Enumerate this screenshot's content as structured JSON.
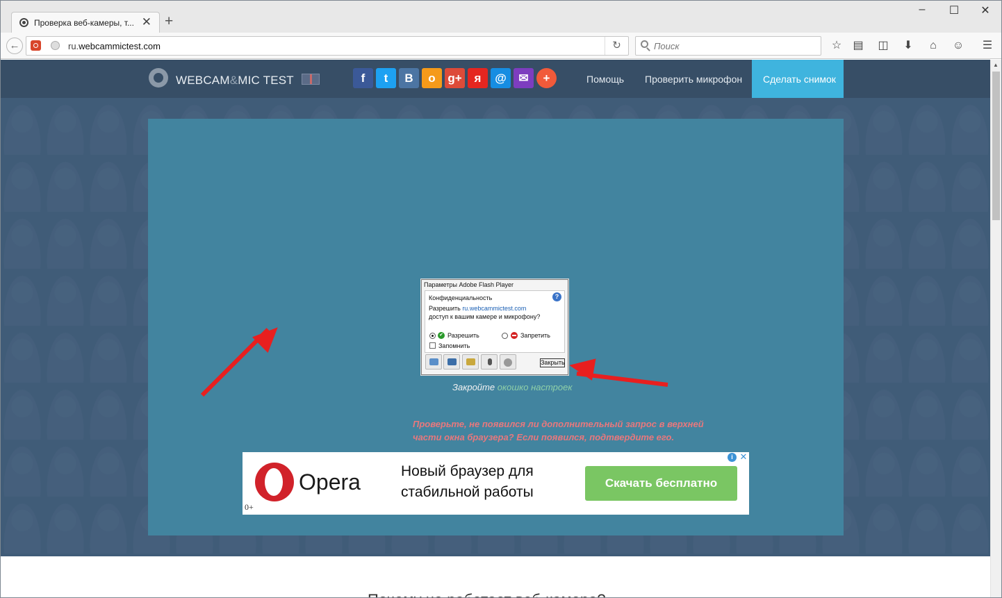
{
  "browser": {
    "tab_title": "Проверка веб-камеры, т...",
    "tab_close": "✕",
    "new_tab": "+",
    "url_prefix": "ru.",
    "url_domain": "webcammictest.com",
    "search_placeholder": "Поиск",
    "window_controls": [
      "–",
      "☐",
      "✕"
    ]
  },
  "site": {
    "logo_main": "WEBCAM",
    "logo_amp": "&",
    "logo_end": "MIC TEST",
    "social": [
      {
        "icon": "facebook-icon",
        "glyph": "f",
        "color": "#3b5998"
      },
      {
        "icon": "twitter-icon",
        "glyph": "t",
        "color": "#1da1f2"
      },
      {
        "icon": "vk-icon",
        "glyph": "B",
        "color": "#4c75a3"
      },
      {
        "icon": "odnoklassniki-icon",
        "glyph": "o",
        "color": "#f59a1a"
      },
      {
        "icon": "google-plus-icon",
        "glyph": "g+",
        "color": "#dd4b39"
      },
      {
        "icon": "yandex-icon",
        "glyph": "я",
        "color": "#e52620"
      },
      {
        "icon": "mailru-icon",
        "glyph": "@",
        "color": "#168de2"
      },
      {
        "icon": "email-icon",
        "glyph": "✉",
        "color": "#7d3dbf"
      },
      {
        "icon": "more-share-icon",
        "glyph": "+",
        "color": "#f15a3a"
      }
    ],
    "nav": {
      "help": "Помощь",
      "check_mic": "Проверить микрофон",
      "snapshot": "Сделать снимок"
    }
  },
  "flash_dialog": {
    "title": "Параметры Adobe Flash Player",
    "section": "Конфиденциальность",
    "help": "?",
    "allow_line_prefix": "Разрешить ",
    "allow_line_domain": "ru.webcammictest.com",
    "allow_line_2": "доступ к вашим камере и микрофону?",
    "allow": "Разрешить",
    "deny": "Запретить",
    "remember": "Запомнить",
    "close": "Закрыть"
  },
  "hints": {
    "close_prefix": "Закройте",
    "close_suffix": "окошко настроек",
    "warning": "Проверьте, не появился ли дополнительный запрос в верхней части окна браузера? Если появился, подтвердите его."
  },
  "ad": {
    "brand": "Opera",
    "age": "0+",
    "line1": "Новый браузер для",
    "line2": "стабильной работы",
    "cta": "Скачать бесплатно",
    "info": "i",
    "close": "✕"
  },
  "lower": {
    "title": "Почему не работает веб-камера?"
  }
}
